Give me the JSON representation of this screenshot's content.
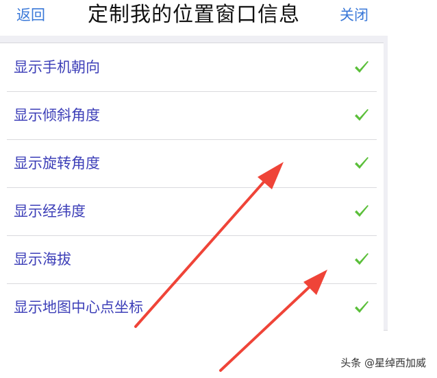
{
  "navbar": {
    "back_label": "返回",
    "title": "定制我的位置窗口信息",
    "close_label": "关闭"
  },
  "settings": {
    "items": [
      {
        "label": "显示手机朝向",
        "checked": true
      },
      {
        "label": "显示倾斜角度",
        "checked": true
      },
      {
        "label": "显示旋转角度",
        "checked": true
      },
      {
        "label": "显示经纬度",
        "checked": true
      },
      {
        "label": "显示海拔",
        "checked": true
      },
      {
        "label": "显示地图中心点坐标",
        "checked": true
      }
    ]
  },
  "watermark": "头条 @星绰西加威",
  "colors": {
    "link_blue": "#3a78d8",
    "item_text": "#3d3fb8",
    "check_green": "#5bbf3a",
    "arrow_red": "#ef4438",
    "panel_bg": "#efeff4"
  },
  "icons": {
    "check": "check-icon",
    "arrow": "red-annotation-arrow"
  }
}
